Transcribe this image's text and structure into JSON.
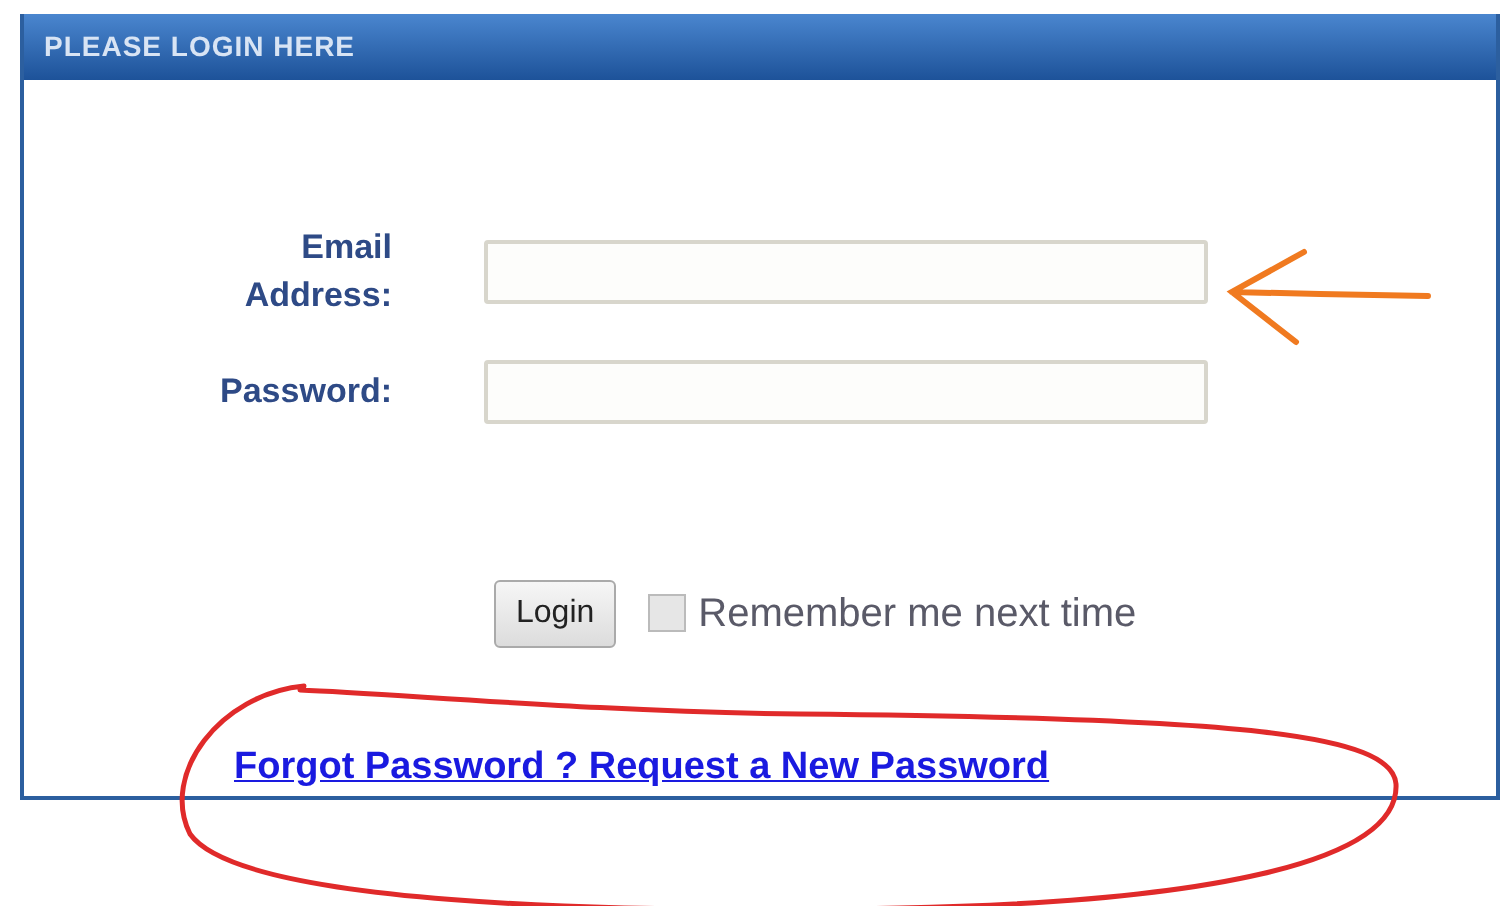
{
  "panel": {
    "title": "PLEASE LOGIN HERE"
  },
  "fields": [
    {
      "label": "Email Address:"
    },
    {
      "label": "Password:"
    }
  ],
  "login_button": "Login",
  "remember": {
    "label": "Remember me next time",
    "checked": false
  },
  "link": "Forgot Password ? Request a New Password",
  "annotations": [
    {
      "kind": "arrow",
      "color": "#f07a20"
    },
    {
      "kind": "ellipse",
      "color": "#e02a2a"
    }
  ]
}
